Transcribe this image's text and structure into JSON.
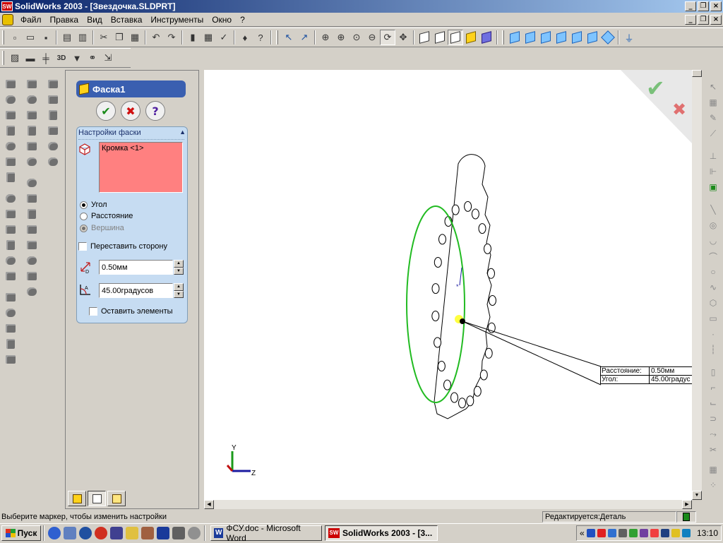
{
  "window": {
    "title": "SolidWorks 2003 - [Звездочка.SLDPRT]",
    "app_icon": "SW",
    "caption_buttons": [
      "_",
      "❐",
      "×"
    ]
  },
  "menu": {
    "items": [
      "Файл",
      "Правка",
      "Вид",
      "Вставка",
      "Инструменты",
      "Окно",
      "?"
    ]
  },
  "property_manager": {
    "title": "Фаска1",
    "ok_symbol": "✔",
    "cancel_symbol": "✖",
    "help_symbol": "?",
    "group_title": "Настройки фаски",
    "collapse_symbol": "▲",
    "selection_list": [
      "Кромка <1>"
    ],
    "selection_color": "#ff8080",
    "options": [
      {
        "label": "Угол",
        "state": "selected"
      },
      {
        "label": "Расстояние",
        "state": "unselected"
      },
      {
        "label": "Вершина",
        "state": "disabled"
      }
    ],
    "flip_side_label": "Переставить сторону",
    "distance_value": "0.50мм",
    "angle_value": "45.00градусов",
    "keep_features_label": "Оставить элементы",
    "tabs": [
      "feature-manager-tab",
      "property-manager-tab",
      "configuration-manager-tab"
    ]
  },
  "graphics": {
    "callout": {
      "rows": [
        {
          "label": "Расстояние:",
          "value": "0.50мм"
        },
        {
          "label": "Угол:",
          "value": "45.00градус"
        }
      ]
    },
    "axes": {
      "y": "Y",
      "z": "Z"
    },
    "confirm_corner": {
      "ok_symbol": "✔",
      "cancel_symbol": "✖"
    },
    "edge_color": "#22bb22",
    "background": "#ffffff"
  },
  "status": {
    "hint": "Выберите маркер, чтобы изменить настройки",
    "editing": "Редактируется:Деталь"
  },
  "taskbar": {
    "start_label": "Пуск",
    "tasks": [
      {
        "label": "ФСУ.doc - Microsoft Word",
        "icon": "W",
        "active": false
      },
      {
        "label": "SolidWorks 2003 - [3...",
        "icon": "SW",
        "active": true
      }
    ],
    "clock": "13:10",
    "tray_expand": "«"
  },
  "colors": {
    "titlebar_start": "#0a246a",
    "titlebar_end": "#a6caf0",
    "pm_header": "#3a5fb0",
    "ok_green": "#1a8a1a",
    "cancel_red": "#d01010",
    "help_purple": "#5020a0"
  }
}
